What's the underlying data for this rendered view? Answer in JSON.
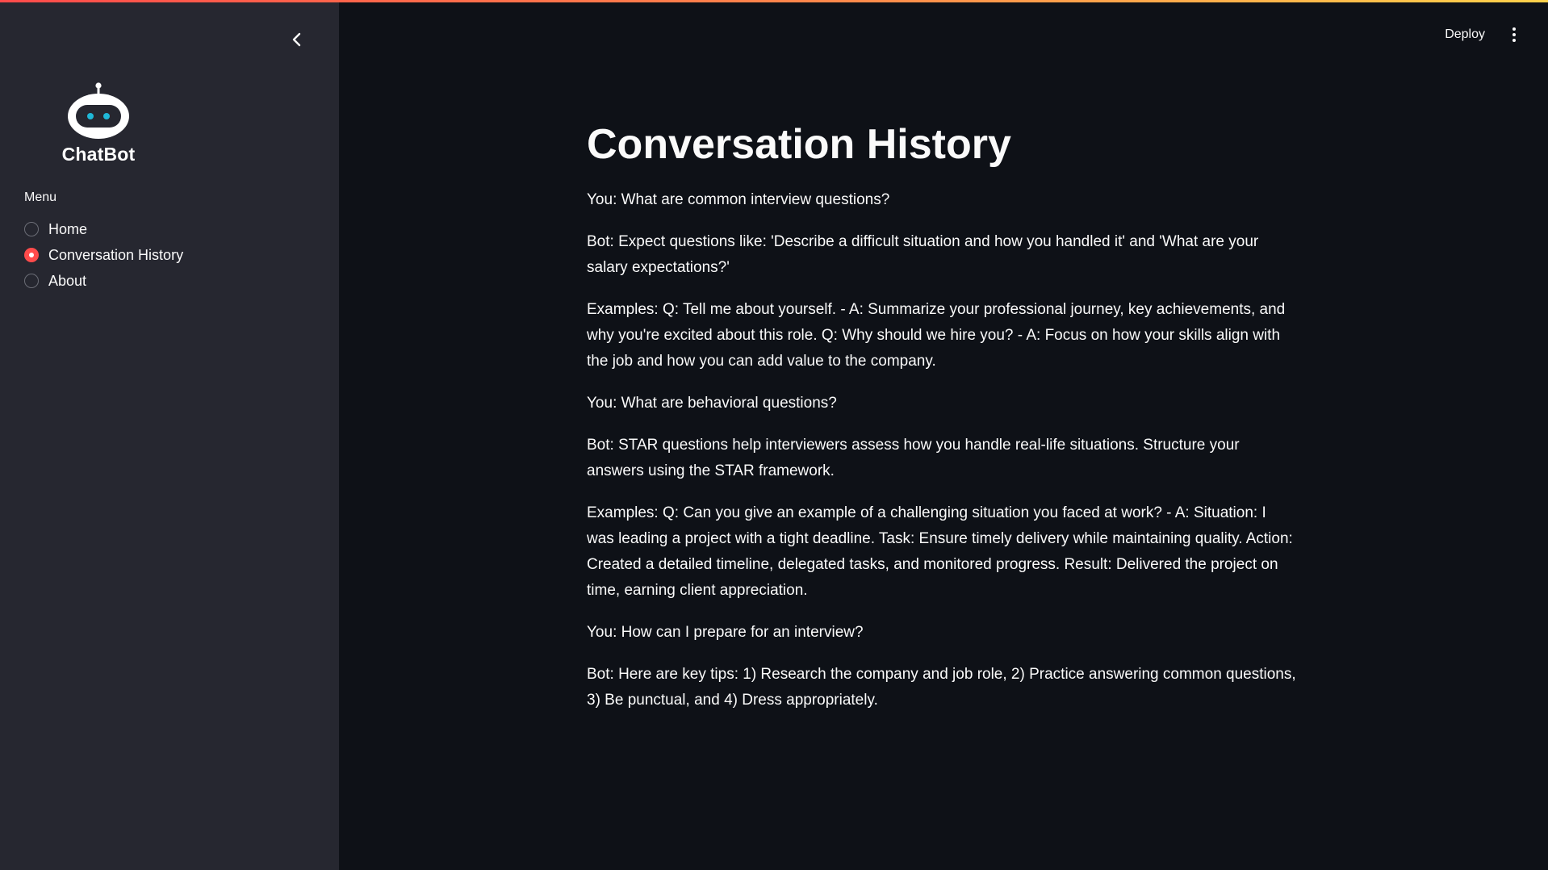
{
  "app": {
    "logo_text": "ChatBot"
  },
  "sidebar": {
    "menu_label": "Menu",
    "items": [
      {
        "label": "Home",
        "selected": false
      },
      {
        "label": "Conversation History",
        "selected": true
      },
      {
        "label": "About",
        "selected": false
      }
    ]
  },
  "header": {
    "deploy_label": "Deploy"
  },
  "main": {
    "title": "Conversation History",
    "messages": [
      "You: What are common interview questions?",
      "Bot: Expect questions like: 'Describe a difficult situation and how you handled it' and 'What are your salary expectations?'",
      "Examples: Q: Tell me about yourself. - A: Summarize your professional journey, key achievements, and why you're excited about this role. Q: Why should we hire you? - A: Focus on how your skills align with the job and how you can add value to the company.",
      "You: What are behavioral questions?",
      "Bot: STAR questions help interviewers assess how you handle real-life situations. Structure your answers using the STAR framework.",
      "Examples: Q: Can you give an example of a challenging situation you faced at work? - A: Situation: I was leading a project with a tight deadline. Task: Ensure timely delivery while maintaining quality. Action: Created a detailed timeline, delegated tasks, and monitored progress. Result: Delivered the project on time, earning client appreciation.",
      "You: How can I prepare for an interview?",
      "Bot: Here are key tips: 1) Research the company and job role, 2) Practice answering common questions, 3) Be punctual, and 4) Dress appropriately."
    ]
  },
  "icons": {
    "collapse": "chevron-left-icon",
    "logo": "robot-icon",
    "menu": "kebab-menu-icon"
  },
  "colors": {
    "accent": "#ff4b4b",
    "sidebar_bg": "#262730",
    "main_bg": "#0e1117",
    "robot_eyes": "#1fb8d8"
  }
}
